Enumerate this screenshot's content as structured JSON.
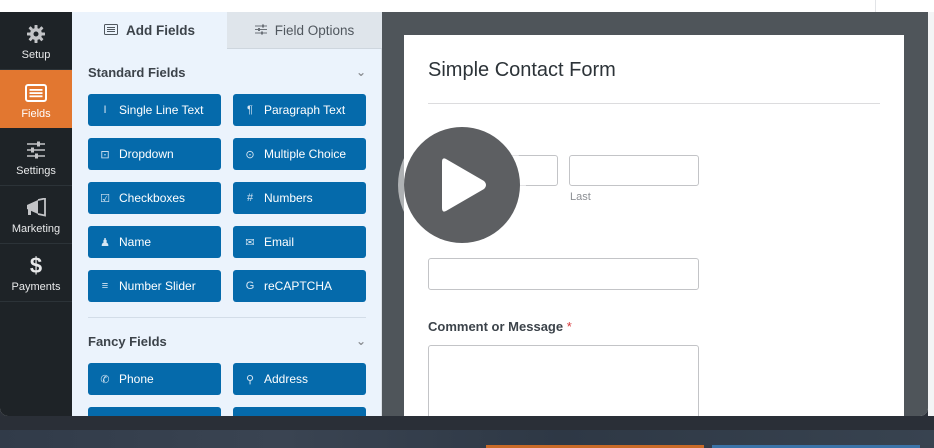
{
  "sidebar": {
    "items": [
      {
        "label": "Setup",
        "icon": "gear-icon"
      },
      {
        "label": "Fields",
        "icon": "fields-list-icon",
        "active": true
      },
      {
        "label": "Settings",
        "icon": "sliders-icon"
      },
      {
        "label": "Marketing",
        "icon": "megaphone-icon"
      },
      {
        "label": "Payments",
        "icon": "dollar-icon",
        "glyph": "$"
      }
    ]
  },
  "panel": {
    "tabs": [
      {
        "label": "Add Fields",
        "icon": "list-icon"
      },
      {
        "label": "Field Options",
        "icon": "sliders-icon"
      }
    ],
    "standard": {
      "title": "Standard Fields",
      "buttons": [
        {
          "label": "Single Line Text",
          "glyph": "I",
          "icon": "text-cursor-icon"
        },
        {
          "label": "Paragraph Text",
          "glyph": "¶",
          "icon": "pilcrow-icon"
        },
        {
          "label": "Dropdown",
          "glyph": "⊡",
          "icon": "dropdown-icon"
        },
        {
          "label": "Multiple Choice",
          "glyph": "⊙",
          "icon": "radio-icon"
        },
        {
          "label": "Checkboxes",
          "glyph": "☑",
          "icon": "checkbox-icon"
        },
        {
          "label": "Numbers",
          "glyph": "#",
          "icon": "hash-icon"
        },
        {
          "label": "Name",
          "glyph": "♟",
          "icon": "user-icon"
        },
        {
          "label": "Email",
          "glyph": "✉",
          "icon": "envelope-icon"
        },
        {
          "label": "Number Slider",
          "glyph": "≡",
          "icon": "slider-icon"
        },
        {
          "label": "reCAPTCHA",
          "glyph": "G",
          "icon": "google-icon"
        }
      ]
    },
    "fancy": {
      "title": "Fancy Fields",
      "buttons": [
        {
          "label": "Phone",
          "glyph": "✆",
          "icon": "phone-icon"
        },
        {
          "label": "Address",
          "glyph": "⚲",
          "icon": "map-pin-icon"
        }
      ]
    },
    "chevron": "⌄"
  },
  "form": {
    "title": "Simple Contact Form",
    "last_sublabel": "Last",
    "comment_label": "Comment or Message",
    "required_mark": "*"
  },
  "colors": {
    "accent": "#e27730",
    "button": "#056aab",
    "sidebar": "#1e2327"
  }
}
